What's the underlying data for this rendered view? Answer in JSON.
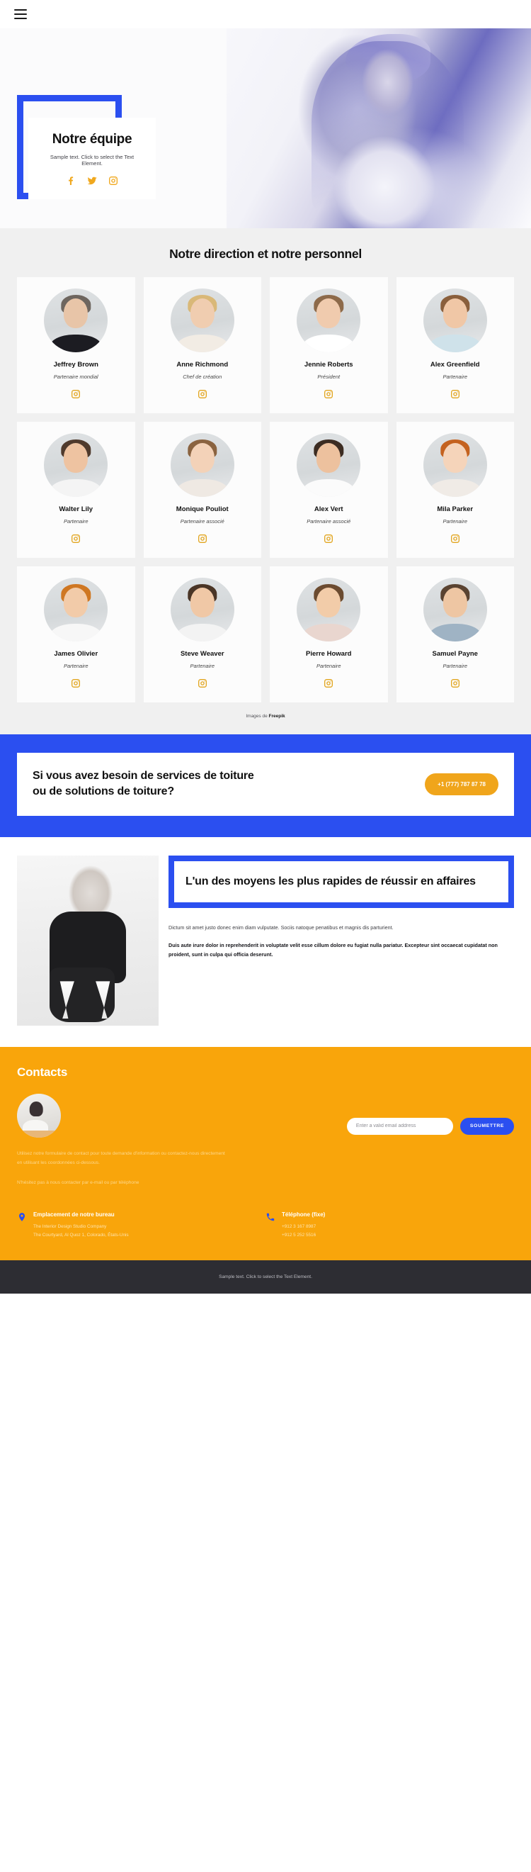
{
  "topbar": {
    "menu_icon": "hamburger-menu-icon"
  },
  "hero": {
    "title": "Notre équipe",
    "subtitle": "Sample text. Click to select the Text Element.",
    "socials": [
      {
        "name": "facebook-icon",
        "label": "Facebook"
      },
      {
        "name": "twitter-icon",
        "label": "Twitter"
      },
      {
        "name": "instagram-icon",
        "label": "Instagram"
      }
    ]
  },
  "team": {
    "heading": "Notre direction et notre personnel",
    "credit_prefix": "Images de ",
    "credit_source": "Freepik",
    "members": [
      {
        "name": "Jeffrey Brown",
        "role": "Partenaire mondial",
        "hair": "#6e665f",
        "skin": "#e8c5a8",
        "body": "#1c1c22"
      },
      {
        "name": "Anne Richmond",
        "role": "Chef de création",
        "hair": "#d9b878",
        "skin": "#f0cdb0",
        "body": "#f2ece4"
      },
      {
        "name": "Jennie Roberts",
        "role": "Président",
        "hair": "#8d6a4a",
        "skin": "#f0cbae",
        "body": "#ffffff"
      },
      {
        "name": "Alex Greenfield",
        "role": "Partenaire",
        "hair": "#8a5f3c",
        "skin": "#f0c7a6",
        "body": "#cfe2ea"
      },
      {
        "name": "Walter Lily",
        "role": "Partenaire",
        "hair": "#4f3a2c",
        "skin": "#eec3a1",
        "body": "#f4f4f4"
      },
      {
        "name": "Monique Pouliot",
        "role": "Partenaire associé",
        "hair": "#8a6340",
        "skin": "#f3d2b8",
        "body": "#efe9e3"
      },
      {
        "name": "Alex Vert",
        "role": "Partenaire associé",
        "hair": "#3c2c22",
        "skin": "#edc19e",
        "body": "#fbfbfb"
      },
      {
        "name": "Mila Parker",
        "role": "Partenaire",
        "hair": "#c4621f",
        "skin": "#f5d4ba",
        "body": "#f0ebe6"
      },
      {
        "name": "James Olivier",
        "role": "Partenaire",
        "hair": "#cf7722",
        "skin": "#f2cba9",
        "body": "#f7f7f7"
      },
      {
        "name": "Steve Weaver",
        "role": "Partenaire",
        "hair": "#4a3526",
        "skin": "#f0c8a6",
        "body": "#f3f3f3"
      },
      {
        "name": "Pierre Howard",
        "role": "Partenaire",
        "hair": "#6b4b30",
        "skin": "#f2cca9",
        "body": "#e9d6cf"
      },
      {
        "name": "Samuel Payne",
        "role": "Partenaire",
        "hair": "#5a4331",
        "skin": "#eec6a3",
        "body": "#9fb3c4"
      }
    ]
  },
  "cta": {
    "heading": "Si vous avez besoin de services de toiture ou de solutions de toiture?",
    "phone": "+1 (777) 787 87 78"
  },
  "feature": {
    "heading": "L'un des moyens les plus rapides de réussir en affaires",
    "paragraph": "Dictum sit amet justo donec enim diam vulputate. Sociis natoque penatibus et magnis dis parturient.",
    "paragraph_bold": "Duis aute irure dolor in reprehenderit in voluptate velit esse cillum dolore eu fugiat nulla pariatur. Excepteur sint occaecat cupidatat non proident, sunt in culpa qui officia deserunt."
  },
  "contacts": {
    "heading": "Contacts",
    "intro_1": "Utilisez notre formulaire de contact pour toute demande d'information ou contactez-nous directement en utilisant les coordonnées ci-dessous.",
    "intro_2": "N'hésitez pas à nous contacter par e-mail ou par téléphone",
    "email_placeholder": "Enter a valid email address",
    "email_value": "",
    "submit_label": "SOUMETTRE",
    "office": {
      "icon": "location-pin-icon",
      "title": "Emplacement de notre bureau",
      "line1": "The Interior Design Studio Company",
      "line2": "The Courtyard, Al Quoz 1, Colorado, États-Unis"
    },
    "phone": {
      "icon": "phone-icon",
      "title": "Téléphone (fixe)",
      "line1": "+912 3 167 8987",
      "line2": "+912 5 252 5516"
    }
  },
  "footer": {
    "text": "Sample text. Click to select the Text Element."
  },
  "colors": {
    "blue": "#2b4ff0",
    "orange": "#f9a50b",
    "gold": "#e2a51f",
    "dark": "#2d2d33",
    "team_bg": "#f0f0f0"
  }
}
